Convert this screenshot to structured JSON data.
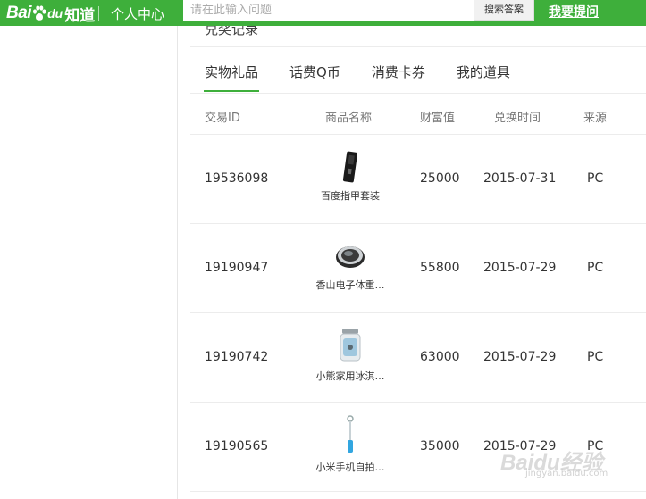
{
  "header": {
    "logo_bai": "Bai",
    "logo_du": "du",
    "logo_zhidao": "知道",
    "center_link": "个人中心",
    "search_placeholder": "请在此输入问题",
    "search_button": "搜索答案",
    "ask_link": "我要提问"
  },
  "section_title": "兑奖记录",
  "tabs": [
    {
      "label": "实物礼品",
      "active": true
    },
    {
      "label": "话费Q币",
      "active": false
    },
    {
      "label": "消费卡券",
      "active": false
    },
    {
      "label": "我的道具",
      "active": false
    }
  ],
  "table": {
    "columns": [
      "交易ID",
      "商品名称",
      "财富值",
      "兑换时间",
      "来源"
    ],
    "rows": [
      {
        "id": "19536098",
        "product": "百度指甲套装",
        "icon": "nail-kit-icon",
        "wealth": "25000",
        "date": "2015-07-31",
        "source": "PC"
      },
      {
        "id": "19190947",
        "product": "香山电子体重…",
        "icon": "scale-icon",
        "wealth": "55800",
        "date": "2015-07-29",
        "source": "PC"
      },
      {
        "id": "19190742",
        "product": "小熊家用冰淇…",
        "icon": "ice-cream-maker-icon",
        "wealth": "63000",
        "date": "2015-07-29",
        "source": "PC"
      },
      {
        "id": "19190565",
        "product": "小米手机自拍…",
        "icon": "selfie-stick-icon",
        "wealth": "35000",
        "date": "2015-07-29",
        "source": "PC"
      }
    ]
  },
  "watermark": {
    "brand": "Baidu经验",
    "url": "jingyan.baidu.com"
  },
  "colors": {
    "brand_green": "#3eaf3b",
    "divider": "#ececec"
  }
}
